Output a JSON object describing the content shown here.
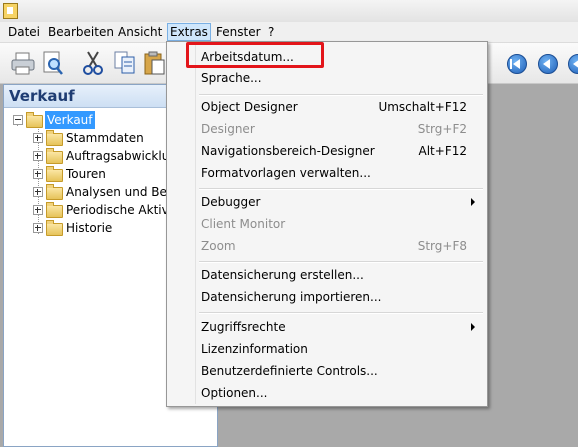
{
  "menubar": {
    "items": [
      {
        "label": "Datei"
      },
      {
        "label": "Bearbeiten"
      },
      {
        "label": "Ansicht"
      },
      {
        "label": "Extras"
      },
      {
        "label": "Fenster"
      },
      {
        "label": "?"
      }
    ],
    "active": "Extras"
  },
  "toolbar": {
    "icons": [
      "print-icon",
      "print-preview-icon",
      "cut-icon",
      "copy-icon",
      "paste-icon"
    ],
    "nav_icons": [
      "first-record-icon",
      "previous-record-icon",
      "next-record-icon"
    ]
  },
  "panel": {
    "title": "Verkauf",
    "tree": [
      {
        "label": "Verkauf",
        "selected": true
      },
      {
        "label": "Stammdaten"
      },
      {
        "label": "Auftragsabwicklun"
      },
      {
        "label": "Touren"
      },
      {
        "label": "Analysen und Berich"
      },
      {
        "label": "Periodische Aktivit"
      },
      {
        "label": "Historie"
      }
    ]
  },
  "dropdown": {
    "items": [
      {
        "label": "Arbeitsdatum...",
        "shortcut": "",
        "disabled": false
      },
      {
        "label": "Sprache...",
        "shortcut": "",
        "disabled": false
      },
      {
        "label": "Object Designer",
        "shortcut": "Umschalt+F12",
        "disabled": false
      },
      {
        "label": "Designer",
        "shortcut": "Strg+F2",
        "disabled": true
      },
      {
        "label": "Navigationsbereich-Designer",
        "shortcut": "Alt+F12",
        "disabled": false
      },
      {
        "label": "Formatvorlagen verwalten...",
        "shortcut": "",
        "disabled": false
      },
      {
        "label": "Debugger",
        "shortcut": "",
        "disabled": false,
        "submenu": true
      },
      {
        "label": "Client Monitor",
        "shortcut": "",
        "disabled": true
      },
      {
        "label": "Zoom",
        "shortcut": "Strg+F8",
        "disabled": true
      },
      {
        "label": "Datensicherung erstellen...",
        "shortcut": "",
        "disabled": false
      },
      {
        "label": "Datensicherung importieren...",
        "shortcut": "",
        "disabled": false
      },
      {
        "label": "Zugriffsrechte",
        "shortcut": "",
        "disabled": false,
        "submenu": true
      },
      {
        "label": "Lizenzinformation",
        "shortcut": "",
        "disabled": false
      },
      {
        "label": "Benutzerdefinierte Controls...",
        "shortcut": "",
        "disabled": false
      },
      {
        "label": "Optionen...",
        "shortcut": "",
        "disabled": false
      }
    ]
  },
  "colors": {
    "highlight": "#e3151a",
    "selection": "#3399ff",
    "panel_title": "#1e3c72"
  }
}
